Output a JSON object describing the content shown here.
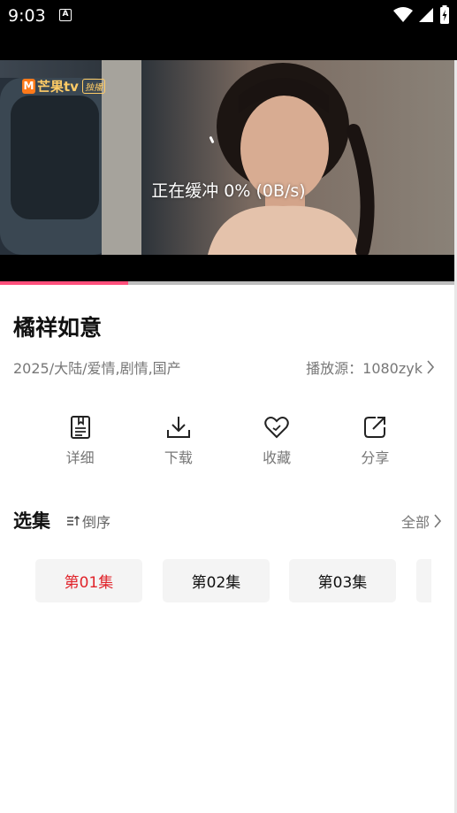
{
  "status": {
    "time": "9:03",
    "a_icon": "A"
  },
  "player": {
    "logo_mark": "M",
    "logo_text": "芒果tv",
    "logo_badge": "独播",
    "buffering_text": "正在缓冲 0% (0B/s)",
    "progress_percent": 28
  },
  "show": {
    "title": "橘祥如意",
    "meta": "2025/大陆/爱情,剧情,国产",
    "source_label": "播放源：1080zyk"
  },
  "actions": [
    {
      "icon": "detail-icon",
      "label": "详细"
    },
    {
      "icon": "download-icon",
      "label": "下载"
    },
    {
      "icon": "favorite-icon",
      "label": "收藏"
    },
    {
      "icon": "share-icon",
      "label": "分享"
    }
  ],
  "episodes": {
    "heading": "选集",
    "order_label": "倒序",
    "all_label": "全部",
    "items": [
      "第01集",
      "第02集",
      "第03集"
    ],
    "active_index": 0,
    "active_color": "#e0242b"
  }
}
